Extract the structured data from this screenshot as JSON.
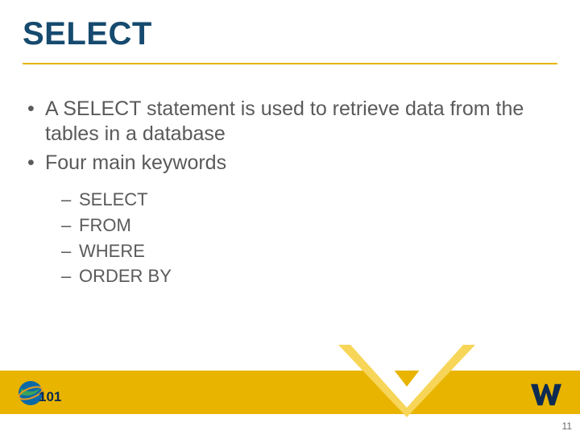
{
  "title": "SELECT",
  "bullets": [
    "A SELECT statement is used to retrieve data from the tables in a database",
    "Four main keywords"
  ],
  "sub_keywords": [
    "SELECT",
    "FROM",
    "WHERE",
    "ORDER BY"
  ],
  "page_number": "11",
  "colors": {
    "title": "#164a6f",
    "accent": "#e8b400",
    "text": "#5a5a5a",
    "wv_navy": "#0c2a52",
    "wv_gold": "#e8b400"
  },
  "logos": {
    "left": "101-globe-logo",
    "right": "wv-flying-logo"
  }
}
